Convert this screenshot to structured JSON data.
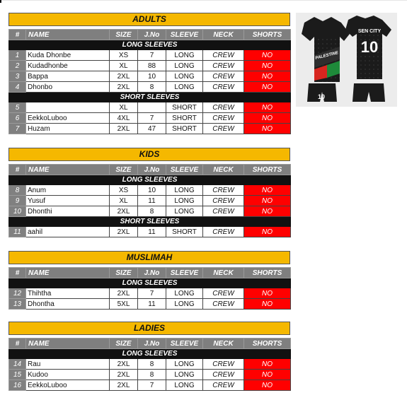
{
  "columns": [
    "#",
    "NAME",
    "SIZE",
    "J.No",
    "SLEEVE",
    "NECK",
    "SHORTS"
  ],
  "sections": [
    {
      "title": "ADULTS",
      "groups": [
        {
          "label": "LONG SLEEVES",
          "rows": [
            {
              "no": "1",
              "name": "Kuda Dhonbe",
              "size": "XS",
              "jno": "7",
              "sleeve": "LONG",
              "neck": "CREW",
              "shorts": "NO"
            },
            {
              "no": "2",
              "name": "Kudadhonbe",
              "size": "XL",
              "jno": "88",
              "sleeve": "LONG",
              "neck": "CREW",
              "shorts": "NO"
            },
            {
              "no": "3",
              "name": "Bappa",
              "size": "2XL",
              "jno": "10",
              "sleeve": "LONG",
              "neck": "CREW",
              "shorts": "NO"
            },
            {
              "no": "4",
              "name": "Dhonbo",
              "size": "2XL",
              "jno": "8",
              "sleeve": "LONG",
              "neck": "CREW",
              "shorts": "NO"
            }
          ]
        },
        {
          "label": "SHORT SLEEVES",
          "rows": [
            {
              "no": "5",
              "name": "",
              "size": "XL",
              "jno": "",
              "sleeve": "SHORT",
              "neck": "CREW",
              "shorts": "NO"
            },
            {
              "no": "6",
              "name": "EekkoLuboo",
              "size": "4XL",
              "jno": "7",
              "sleeve": "SHORT",
              "neck": "CREW",
              "shorts": "NO"
            },
            {
              "no": "7",
              "name": "Huzam",
              "size": "2XL",
              "jno": "47",
              "sleeve": "SHORT",
              "neck": "CREW",
              "shorts": "NO"
            }
          ]
        }
      ]
    },
    {
      "title": "KIDS",
      "groups": [
        {
          "label": "LONG SLEEVES",
          "rows": [
            {
              "no": "8",
              "name": "Anum",
              "size": "XS",
              "jno": "10",
              "sleeve": "LONG",
              "neck": "CREW",
              "shorts": "NO"
            },
            {
              "no": "9",
              "name": "Yusuf",
              "size": "XL",
              "jno": "11",
              "sleeve": "LONG",
              "neck": "CREW",
              "shorts": "NO"
            },
            {
              "no": "10",
              "name": "Dhonthi",
              "size": "2XL",
              "jno": "8",
              "sleeve": "LONG",
              "neck": "CREW",
              "shorts": "NO"
            }
          ]
        },
        {
          "label": "SHORT SLEEVES",
          "rows": [
            {
              "no": "11",
              "name": "aahil",
              "size": "2XL",
              "jno": "11",
              "sleeve": "SHORT",
              "neck": "CREW",
              "shorts": "NO"
            }
          ]
        }
      ]
    },
    {
      "title": "MUSLIMAH",
      "groups": [
        {
          "label": "LONG SLEEVES",
          "rows": [
            {
              "no": "12",
              "name": "Thihtha",
              "size": "2XL",
              "jno": "7",
              "sleeve": "LONG",
              "neck": "CREW",
              "shorts": "NO"
            },
            {
              "no": "13",
              "name": "Dhontha",
              "size": "5XL",
              "jno": "11",
              "sleeve": "LONG",
              "neck": "CREW",
              "shorts": "NO"
            }
          ]
        }
      ]
    },
    {
      "title": "LADIES",
      "groups": [
        {
          "label": "LONG SLEEVES",
          "rows": [
            {
              "no": "14",
              "name": "Rau",
              "size": "2XL",
              "jno": "8",
              "sleeve": "LONG",
              "neck": "CREW",
              "shorts": "NO"
            },
            {
              "no": "15",
              "name": "Kudoo",
              "size": "2XL",
              "jno": "8",
              "sleeve": "LONG",
              "neck": "CREW",
              "shorts": "NO"
            },
            {
              "no": "16",
              "name": "EekkoLuboo",
              "size": "2XL",
              "jno": "7",
              "sleeve": "LONG",
              "neck": "CREW",
              "shorts": "NO"
            }
          ]
        }
      ]
    }
  ],
  "jersey_preview": {
    "team_text": "SEN CITY",
    "number": "10",
    "chest_text": "PALESTINE",
    "shorts_number": "10",
    "colors": {
      "body": "#1b1b1b",
      "panel": "#2e2e2e",
      "accent_red": "#d8261f",
      "accent_green": "#1e8a3a",
      "text": "#ffffff"
    }
  },
  "colors": {
    "title_bar": "#f5b800",
    "header": "#7f7f7f",
    "group_bar": "#111111",
    "no_flag": "#ff0000"
  }
}
